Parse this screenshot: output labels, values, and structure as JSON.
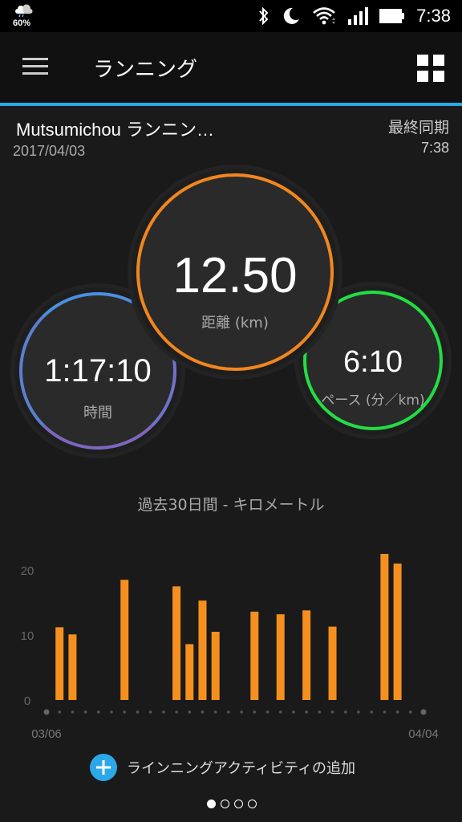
{
  "status_bar": {
    "battery_percent": "60%",
    "clock": "7:38",
    "icons": [
      "weather-icon",
      "bluetooth-icon",
      "moon-icon",
      "wifi-icon",
      "signal-icon",
      "battery-icon"
    ]
  },
  "app_bar": {
    "title": "ランニング",
    "menu_icon": "menu-icon",
    "grid_icon": "grid-icon"
  },
  "activity": {
    "name": "Mutsumichou ランニン…",
    "date": "2017/04/03",
    "sync_label": "最終同期",
    "sync_time": "7:38"
  },
  "metrics": {
    "distance": {
      "value": "12.50",
      "label": "距離 (km)",
      "color": "#f0871e"
    },
    "time": {
      "value": "1:17:10",
      "label": "時間",
      "color": "#4a8fe0"
    },
    "pace": {
      "value": "6:10",
      "label": "ペース (分／km)",
      "color": "#22dd44"
    }
  },
  "chart_data": {
    "type": "bar",
    "title": "過去30日間 - キロメートル",
    "x_start_label": "03/06",
    "x_end_label": "04/04",
    "ylim": [
      0,
      22
    ],
    "yticks": [
      0,
      10,
      20
    ],
    "ytick_labels": [
      "0",
      "10",
      "20"
    ],
    "days": 30,
    "values": [
      0,
      11.2,
      10.1,
      0,
      0,
      0,
      18.5,
      0,
      0,
      0,
      17.5,
      8.6,
      15.3,
      10.5,
      0,
      0,
      13.6,
      0,
      13.2,
      0,
      13.8,
      0,
      11.3,
      0,
      0,
      0,
      23.8,
      21.0,
      0,
      0
    ],
    "bar_color": "#f5901f",
    "grid": false
  },
  "actions": {
    "add_label": "ラインニングアクティビティの追加"
  },
  "pager": {
    "count": 4,
    "active": 0
  }
}
